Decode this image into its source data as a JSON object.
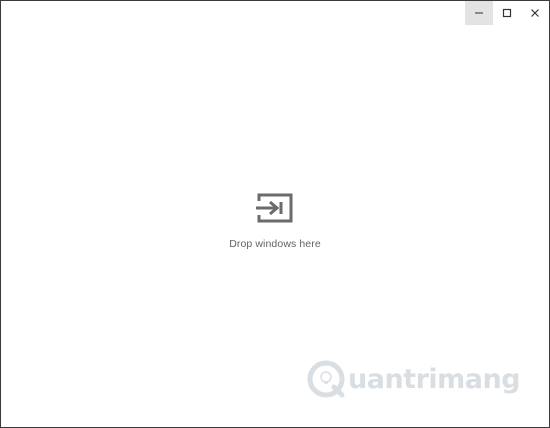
{
  "window": {
    "controls": [
      {
        "name": "minimize-button",
        "icon": "minimize-icon"
      },
      {
        "name": "maximize-button",
        "icon": "maximize-icon"
      },
      {
        "name": "close-button",
        "icon": "close-icon"
      }
    ]
  },
  "empty_state": {
    "icon": "move-window-in-icon",
    "label": "Drop windows here"
  },
  "watermark": {
    "text": "Quantrimang",
    "rest": "uantrimang"
  },
  "colors": {
    "icon": "#6b6b6b",
    "label": "#5f6368",
    "minimize_hover": "#e3e3e3"
  }
}
